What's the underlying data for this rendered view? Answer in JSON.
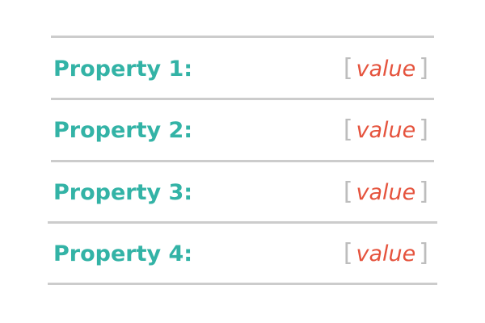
{
  "properties": [
    {
      "label": "Property 1:",
      "value": "value",
      "open_bracket": "[",
      "close_bracket": "]"
    },
    {
      "label": "Property 2:",
      "value": "value",
      "open_bracket": "[",
      "close_bracket": "]"
    },
    {
      "label": "Property 3:",
      "value": "value",
      "open_bracket": "[",
      "close_bracket": "]"
    },
    {
      "label": "Property 4:",
      "value": "value",
      "open_bracket": "[",
      "close_bracket": "]"
    }
  ],
  "colors": {
    "label": "#33b3a6",
    "value": "#e5533d",
    "bracket": "#bdbdbd",
    "divider": "#cccccc"
  }
}
